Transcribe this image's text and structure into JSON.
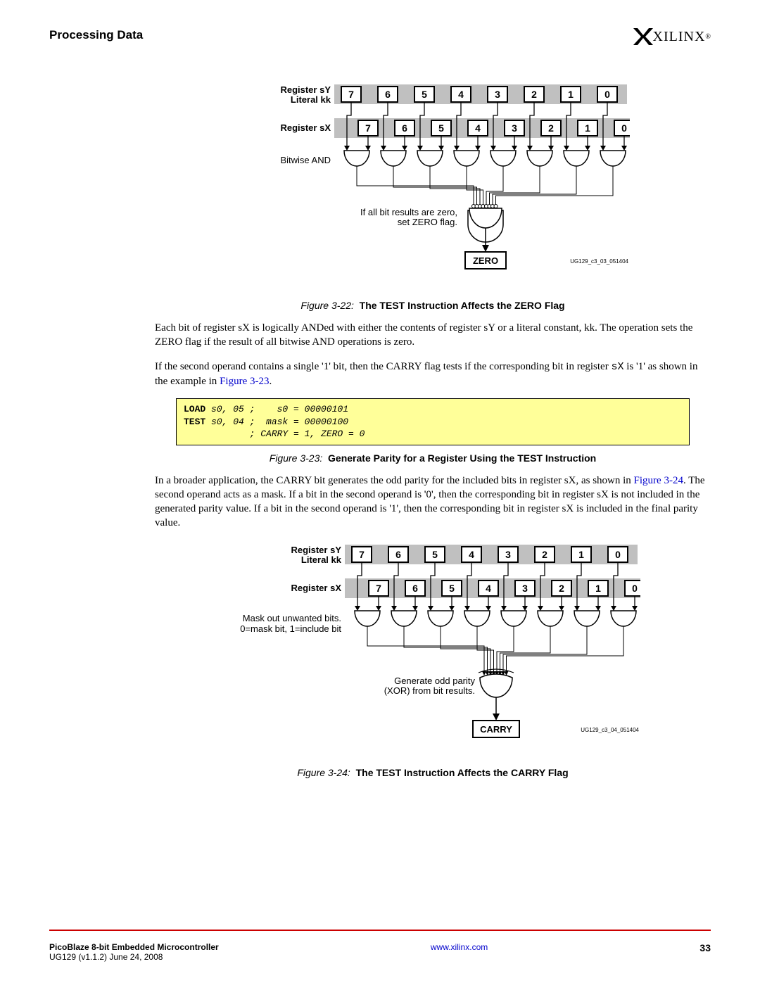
{
  "header": {
    "section_title": "Processing Data",
    "logo_text": "XILINX"
  },
  "figures": {
    "fig22": {
      "num_label": "Figure 3-22:",
      "title": "The TEST Instruction Affects the ZERO Flag",
      "diagram": {
        "row1_label_line1": "Register sY",
        "row1_label_line2": "Literal kk",
        "row2_label": "Register sX",
        "op_label": "Bitwise AND",
        "note_line1": "If all bit results are zero,",
        "note_line2": "set ZERO flag.",
        "result_box": "ZERO",
        "tag": "UG129_c3_03_051404",
        "bits": [
          "7",
          "6",
          "5",
          "4",
          "3",
          "2",
          "1",
          "0"
        ]
      }
    },
    "fig23": {
      "num_label": "Figure 3-23:",
      "title": "Generate Parity for a Register Using the TEST Instruction",
      "code": {
        "line1_kw": "LOAD",
        "line1_rest": " s0, 05 ;    s0 = 00000101",
        "line2_kw": "TEST",
        "line2_rest": " s0, 04 ;  mask = 00000100",
        "line3": "            ; CARRY = 1, ZERO = 0"
      }
    },
    "fig24": {
      "num_label": "Figure 3-24:",
      "title": "The TEST Instruction Affects the CARRY Flag",
      "diagram": {
        "row1_label_line1": "Register sY",
        "row1_label_line2": "Literal kk",
        "row2_label": "Register sX",
        "mask_line1": "Mask out unwanted bits.",
        "mask_line2": "0=mask bit, 1=include bit",
        "parity_line1": "Generate odd parity",
        "parity_line2": "(XOR) from bit results.",
        "result_box": "CARRY",
        "tag": "UG129_c3_04_051404",
        "bits": [
          "7",
          "6",
          "5",
          "4",
          "3",
          "2",
          "1",
          "0"
        ]
      }
    }
  },
  "paragraphs": {
    "p1": "Each bit of register sX is logically ANDed with either the contents of register sY or a literal constant, kk. The operation sets the ZERO flag if the result of all bitwise AND operations is zero.",
    "p2_a": "If the second operand contains a single '1' bit, then the CARRY flag tests if the corresponding bit in register ",
    "p2_b": "sX",
    "p2_c": " is '1' as shown in the example in ",
    "p2_link": "Figure 3-23",
    "p2_d": ".",
    "p3_a": "In a broader application, the CARRY bit generates the odd parity for the included bits in register sX, as shown in ",
    "p3_link": "Figure 3-24",
    "p3_b": ". The second operand acts as a mask. If a bit in the second operand is '0', then the corresponding bit in register sX is not included in the generated parity value. If a bit in the second operand is '1', then the corresponding bit in register sX is included in the final parity value."
  },
  "footer": {
    "doc_title": "PicoBlaze 8-bit Embedded Microcontroller",
    "doc_sub": "UG129 (v1.1.2) June 24, 2008",
    "url": "www.xilinx.com",
    "page": "33"
  }
}
